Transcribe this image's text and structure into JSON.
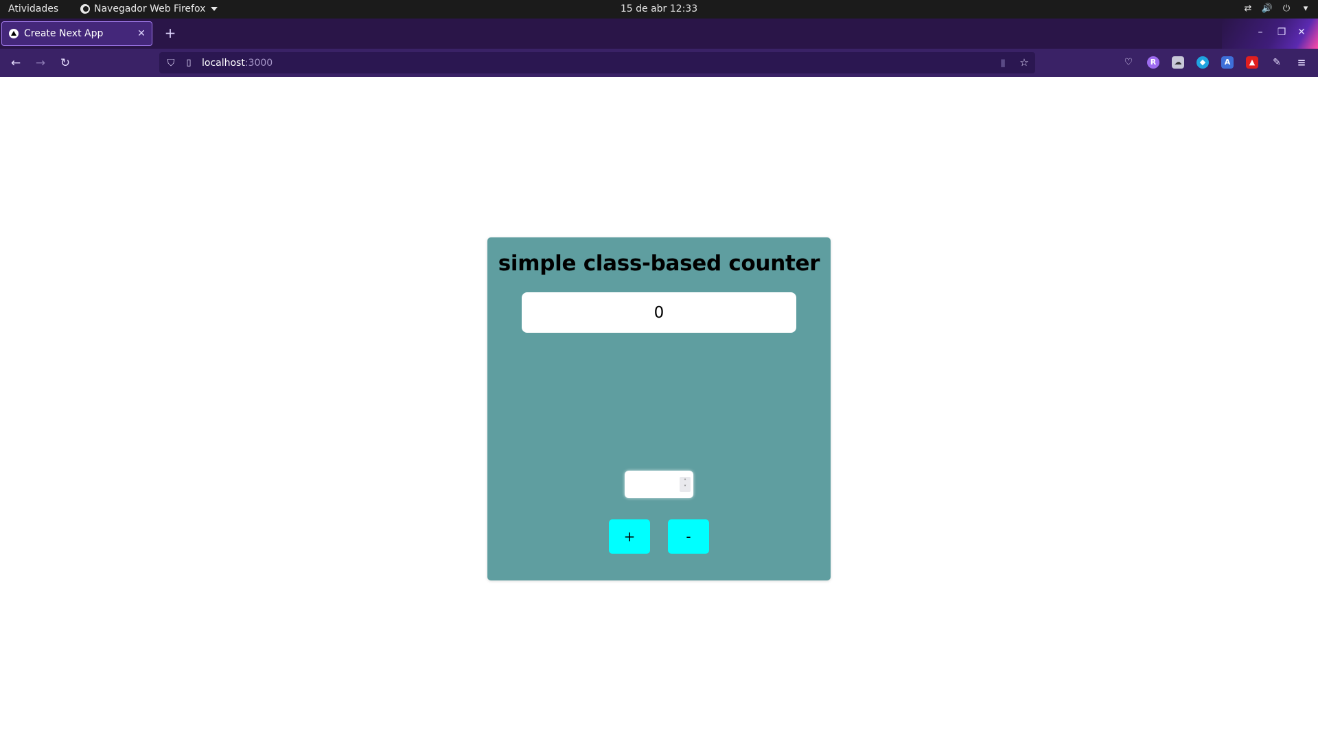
{
  "os_topbar": {
    "activities": "Atividades",
    "app_menu": "Navegador Web Firefox",
    "clock": "15 de abr  12:33"
  },
  "browser": {
    "tab_title": "Create Next App",
    "url_host": "localhost",
    "url_port": ":3000"
  },
  "page": {
    "heading": "simple class-based counter",
    "counter_value": "0",
    "step_input_value": "",
    "increment_label": "+",
    "decrement_label": "-",
    "card_color": "#5f9ea0",
    "button_color": "#00ffff"
  }
}
